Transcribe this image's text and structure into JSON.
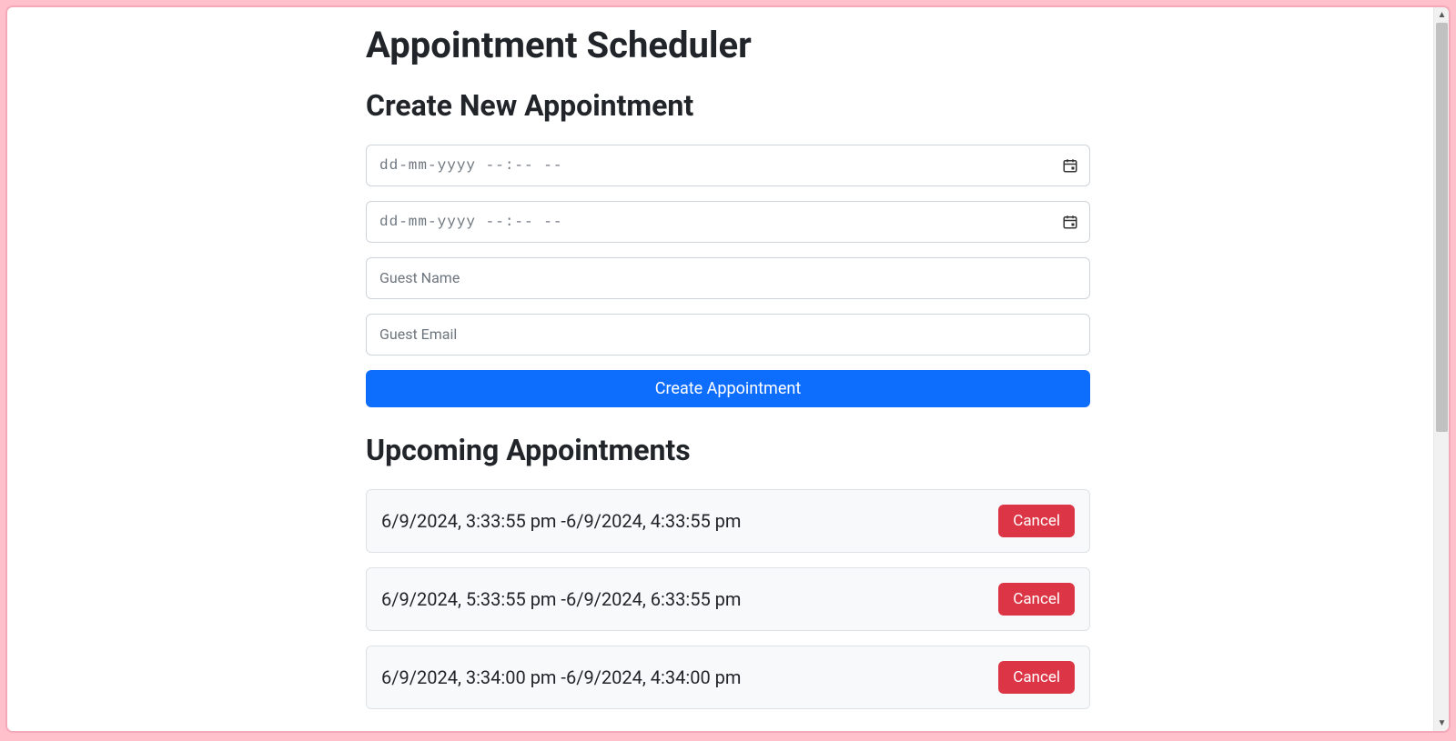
{
  "page": {
    "title": "Appointment Scheduler"
  },
  "form": {
    "heading": "Create New Appointment",
    "start": {
      "value": "",
      "display_placeholder": "dd-mm-yyyy --:-- --"
    },
    "end": {
      "value": "",
      "display_placeholder": "dd-mm-yyyy --:-- --"
    },
    "guest_name": {
      "value": "",
      "placeholder": "Guest Name"
    },
    "guest_email": {
      "value": "",
      "placeholder": "Guest Email"
    },
    "submit_label": "Create Appointment"
  },
  "upcoming": {
    "heading": "Upcoming Appointments",
    "cancel_label": "Cancel",
    "items": [
      {
        "range": "6/9/2024, 3:33:55 pm -6/9/2024, 4:33:55 pm"
      },
      {
        "range": "6/9/2024, 5:33:55 pm -6/9/2024, 6:33:55 pm"
      },
      {
        "range": "6/9/2024, 3:34:00 pm -6/9/2024, 4:34:00 pm"
      }
    ]
  },
  "icons": {
    "calendar": "calendar-icon"
  },
  "colors": {
    "primary": "#0d6efd",
    "danger": "#dc3545",
    "frame_border": "#f5a8b8",
    "body_bg": "#ffc0cb"
  }
}
